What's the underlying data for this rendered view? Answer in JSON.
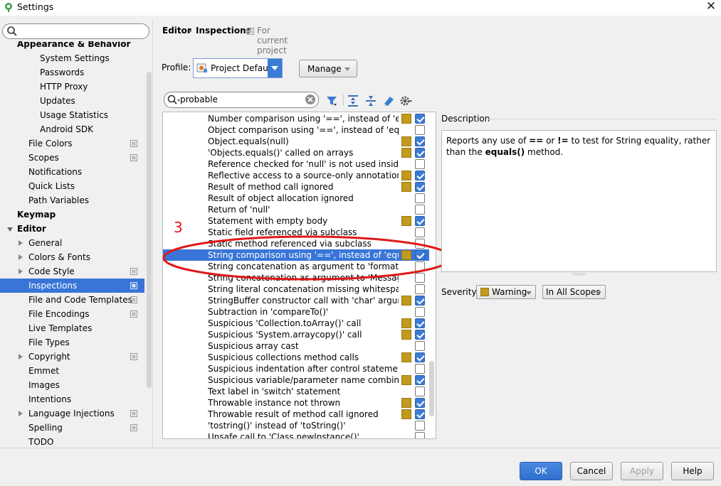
{
  "window": {
    "title": "Settings",
    "close_icon": "close-icon",
    "app_icon": "android-studio-icon"
  },
  "search": {
    "placeholder": "",
    "value": ""
  },
  "sidebar": {
    "items": [
      {
        "label": "Appearance & Behavior",
        "bold": true,
        "indent": 0,
        "arrow": ""
      },
      {
        "label": "System Settings",
        "bold": false,
        "indent": 2,
        "arrow": ""
      },
      {
        "label": "Passwords",
        "bold": false,
        "indent": 2,
        "arrow": ""
      },
      {
        "label": "HTTP Proxy",
        "bold": false,
        "indent": 2,
        "arrow": ""
      },
      {
        "label": "Updates",
        "bold": false,
        "indent": 2,
        "arrow": ""
      },
      {
        "label": "Usage Statistics",
        "bold": false,
        "indent": 2,
        "arrow": ""
      },
      {
        "label": "Android SDK",
        "bold": false,
        "indent": 2,
        "arrow": ""
      },
      {
        "label": "File Colors",
        "bold": false,
        "indent": 1,
        "arrow": "",
        "project": true
      },
      {
        "label": "Scopes",
        "bold": false,
        "indent": 1,
        "arrow": "",
        "project": true
      },
      {
        "label": "Notifications",
        "bold": false,
        "indent": 1,
        "arrow": ""
      },
      {
        "label": "Quick Lists",
        "bold": false,
        "indent": 1,
        "arrow": ""
      },
      {
        "label": "Path Variables",
        "bold": false,
        "indent": 1,
        "arrow": ""
      },
      {
        "label": "Keymap",
        "bold": true,
        "indent": 0,
        "arrow": ""
      },
      {
        "label": "Editor",
        "bold": true,
        "indent": 0,
        "arrow": "down"
      },
      {
        "label": "General",
        "bold": false,
        "indent": 1,
        "arrow": "right"
      },
      {
        "label": "Colors & Fonts",
        "bold": false,
        "indent": 1,
        "arrow": "right"
      },
      {
        "label": "Code Style",
        "bold": false,
        "indent": 1,
        "arrow": "right",
        "project": true
      },
      {
        "label": "Inspections",
        "bold": false,
        "indent": 1,
        "arrow": "",
        "project": true,
        "selected": true
      },
      {
        "label": "File and Code Templates",
        "bold": false,
        "indent": 1,
        "arrow": "",
        "project": true
      },
      {
        "label": "File Encodings",
        "bold": false,
        "indent": 1,
        "arrow": "",
        "project": true
      },
      {
        "label": "Live Templates",
        "bold": false,
        "indent": 1,
        "arrow": ""
      },
      {
        "label": "File Types",
        "bold": false,
        "indent": 1,
        "arrow": ""
      },
      {
        "label": "Copyright",
        "bold": false,
        "indent": 1,
        "arrow": "right",
        "project": true
      },
      {
        "label": "Emmet",
        "bold": false,
        "indent": 1,
        "arrow": ""
      },
      {
        "label": "Images",
        "bold": false,
        "indent": 1,
        "arrow": ""
      },
      {
        "label": "Intentions",
        "bold": false,
        "indent": 1,
        "arrow": ""
      },
      {
        "label": "Language Injections",
        "bold": false,
        "indent": 1,
        "arrow": "right",
        "project": true
      },
      {
        "label": "Spelling",
        "bold": false,
        "indent": 1,
        "arrow": "",
        "project": true
      },
      {
        "label": "TODO",
        "bold": false,
        "indent": 1,
        "arrow": ""
      }
    ]
  },
  "breadcrumb": {
    "parent": "Editor",
    "separator": "›",
    "current": "Inspections",
    "scope": "For current project"
  },
  "profile": {
    "label": "Profile:",
    "value": "Project Default",
    "manage_label": "Manage"
  },
  "filter": {
    "value": "probable"
  },
  "toolbar": {
    "icons": [
      "filter-icon",
      "expand-all-icon",
      "collapse-all-icon",
      "reset-icon",
      "settings-icon"
    ]
  },
  "inspections": [
    {
      "name": "Number comparison using '==', instead of 'equals()'",
      "severity": true,
      "checked": true
    },
    {
      "name": "Object comparison using '==', instead of 'equals()'",
      "severity": false,
      "checked": false
    },
    {
      "name": "Object.equals(null)",
      "severity": true,
      "checked": true
    },
    {
      "name": "'Objects.equals()' called on arrays",
      "severity": true,
      "checked": true
    },
    {
      "name": "Reference checked for 'null' is not used inside 'if'",
      "severity": false,
      "checked": false
    },
    {
      "name": "Reflective access to a source-only annotation",
      "severity": true,
      "checked": true
    },
    {
      "name": "Result of method call ignored",
      "severity": true,
      "checked": true
    },
    {
      "name": "Result of object allocation ignored",
      "severity": false,
      "checked": false
    },
    {
      "name": "Return of 'null'",
      "severity": false,
      "checked": false
    },
    {
      "name": "Statement with empty body",
      "severity": true,
      "checked": true
    },
    {
      "name": "Static field referenced via subclass",
      "severity": false,
      "checked": false
    },
    {
      "name": "Static method referenced via subclass",
      "severity": false,
      "checked": false
    },
    {
      "name": "String comparison using '==', instead of 'equals()'",
      "severity": true,
      "checked": true,
      "selected": true
    },
    {
      "name": "String concatenation as argument to 'format()' call",
      "severity": false,
      "checked": false
    },
    {
      "name": "String concatenation as argument to 'MessageFormat.format()' call",
      "severity": false,
      "checked": false
    },
    {
      "name": "String literal concatenation missing whitespace",
      "severity": false,
      "checked": false
    },
    {
      "name": "StringBuffer constructor call with 'char' argument",
      "severity": true,
      "checked": true
    },
    {
      "name": "Subtraction in 'compareTo()'",
      "severity": false,
      "checked": false
    },
    {
      "name": "Suspicious 'Collection.toArray()' call",
      "severity": true,
      "checked": true
    },
    {
      "name": "Suspicious 'System.arraycopy()' call",
      "severity": true,
      "checked": true
    },
    {
      "name": "Suspicious array cast",
      "severity": false,
      "checked": false
    },
    {
      "name": "Suspicious collections method calls",
      "severity": true,
      "checked": true
    },
    {
      "name": "Suspicious indentation after control statement without braces",
      "severity": false,
      "checked": false
    },
    {
      "name": "Suspicious variable/parameter name combination",
      "severity": true,
      "checked": true
    },
    {
      "name": "Text label in 'switch' statement",
      "severity": false,
      "checked": false
    },
    {
      "name": "Throwable instance not thrown",
      "severity": true,
      "checked": true
    },
    {
      "name": "Throwable result of method call ignored",
      "severity": true,
      "checked": true
    },
    {
      "name": "'tostring()' instead of 'toString()'",
      "severity": false,
      "checked": false
    },
    {
      "name": "Unsafe call to 'Class.newInstance()'",
      "severity": false,
      "checked": false
    }
  ],
  "annotation": {
    "number": "3"
  },
  "description": {
    "title": "Description",
    "text_before": "Reports any use of ",
    "op1": "==",
    "text_or": " or ",
    "op2": "!=",
    "text_mid": " to test for String equality, rather than the ",
    "method": "equals()",
    "text_after": " method."
  },
  "severity": {
    "label": "Severity:",
    "value": "Warning",
    "scope": "In All Scopes"
  },
  "buttons": {
    "ok": "OK",
    "cancel": "Cancel",
    "apply": "Apply",
    "help": "Help"
  },
  "colors": {
    "selection": "#3875d7",
    "warning": "#c19a1e",
    "ok_button": "#2f6fcd",
    "annotation": "#e01818"
  }
}
